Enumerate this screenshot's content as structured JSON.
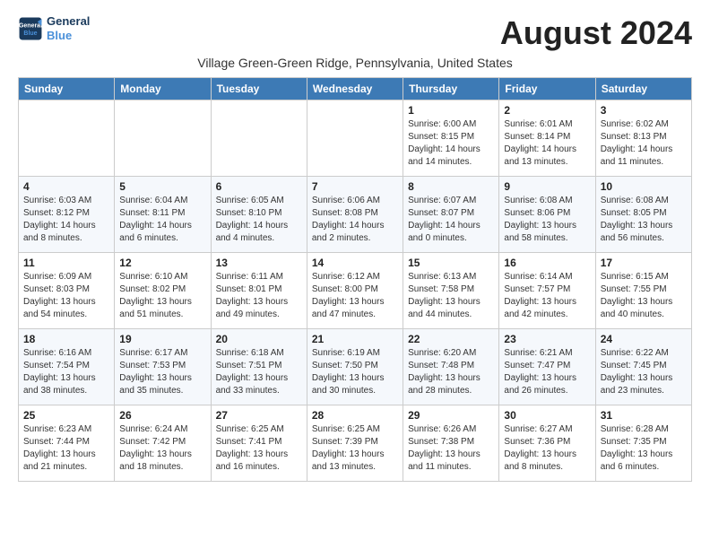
{
  "header": {
    "logo_line1": "General",
    "logo_line2": "Blue",
    "month_title": "August 2024",
    "location": "Village Green-Green Ridge, Pennsylvania, United States"
  },
  "weekdays": [
    "Sunday",
    "Monday",
    "Tuesday",
    "Wednesday",
    "Thursday",
    "Friday",
    "Saturday"
  ],
  "weeks": [
    [
      {
        "day": "",
        "info": ""
      },
      {
        "day": "",
        "info": ""
      },
      {
        "day": "",
        "info": ""
      },
      {
        "day": "",
        "info": ""
      },
      {
        "day": "1",
        "info": "Sunrise: 6:00 AM\nSunset: 8:15 PM\nDaylight: 14 hours\nand 14 minutes."
      },
      {
        "day": "2",
        "info": "Sunrise: 6:01 AM\nSunset: 8:14 PM\nDaylight: 14 hours\nand 13 minutes."
      },
      {
        "day": "3",
        "info": "Sunrise: 6:02 AM\nSunset: 8:13 PM\nDaylight: 14 hours\nand 11 minutes."
      }
    ],
    [
      {
        "day": "4",
        "info": "Sunrise: 6:03 AM\nSunset: 8:12 PM\nDaylight: 14 hours\nand 8 minutes."
      },
      {
        "day": "5",
        "info": "Sunrise: 6:04 AM\nSunset: 8:11 PM\nDaylight: 14 hours\nand 6 minutes."
      },
      {
        "day": "6",
        "info": "Sunrise: 6:05 AM\nSunset: 8:10 PM\nDaylight: 14 hours\nand 4 minutes."
      },
      {
        "day": "7",
        "info": "Sunrise: 6:06 AM\nSunset: 8:08 PM\nDaylight: 14 hours\nand 2 minutes."
      },
      {
        "day": "8",
        "info": "Sunrise: 6:07 AM\nSunset: 8:07 PM\nDaylight: 14 hours\nand 0 minutes."
      },
      {
        "day": "9",
        "info": "Sunrise: 6:08 AM\nSunset: 8:06 PM\nDaylight: 13 hours\nand 58 minutes."
      },
      {
        "day": "10",
        "info": "Sunrise: 6:08 AM\nSunset: 8:05 PM\nDaylight: 13 hours\nand 56 minutes."
      }
    ],
    [
      {
        "day": "11",
        "info": "Sunrise: 6:09 AM\nSunset: 8:03 PM\nDaylight: 13 hours\nand 54 minutes."
      },
      {
        "day": "12",
        "info": "Sunrise: 6:10 AM\nSunset: 8:02 PM\nDaylight: 13 hours\nand 51 minutes."
      },
      {
        "day": "13",
        "info": "Sunrise: 6:11 AM\nSunset: 8:01 PM\nDaylight: 13 hours\nand 49 minutes."
      },
      {
        "day": "14",
        "info": "Sunrise: 6:12 AM\nSunset: 8:00 PM\nDaylight: 13 hours\nand 47 minutes."
      },
      {
        "day": "15",
        "info": "Sunrise: 6:13 AM\nSunset: 7:58 PM\nDaylight: 13 hours\nand 44 minutes."
      },
      {
        "day": "16",
        "info": "Sunrise: 6:14 AM\nSunset: 7:57 PM\nDaylight: 13 hours\nand 42 minutes."
      },
      {
        "day": "17",
        "info": "Sunrise: 6:15 AM\nSunset: 7:55 PM\nDaylight: 13 hours\nand 40 minutes."
      }
    ],
    [
      {
        "day": "18",
        "info": "Sunrise: 6:16 AM\nSunset: 7:54 PM\nDaylight: 13 hours\nand 38 minutes."
      },
      {
        "day": "19",
        "info": "Sunrise: 6:17 AM\nSunset: 7:53 PM\nDaylight: 13 hours\nand 35 minutes."
      },
      {
        "day": "20",
        "info": "Sunrise: 6:18 AM\nSunset: 7:51 PM\nDaylight: 13 hours\nand 33 minutes."
      },
      {
        "day": "21",
        "info": "Sunrise: 6:19 AM\nSunset: 7:50 PM\nDaylight: 13 hours\nand 30 minutes."
      },
      {
        "day": "22",
        "info": "Sunrise: 6:20 AM\nSunset: 7:48 PM\nDaylight: 13 hours\nand 28 minutes."
      },
      {
        "day": "23",
        "info": "Sunrise: 6:21 AM\nSunset: 7:47 PM\nDaylight: 13 hours\nand 26 minutes."
      },
      {
        "day": "24",
        "info": "Sunrise: 6:22 AM\nSunset: 7:45 PM\nDaylight: 13 hours\nand 23 minutes."
      }
    ],
    [
      {
        "day": "25",
        "info": "Sunrise: 6:23 AM\nSunset: 7:44 PM\nDaylight: 13 hours\nand 21 minutes."
      },
      {
        "day": "26",
        "info": "Sunrise: 6:24 AM\nSunset: 7:42 PM\nDaylight: 13 hours\nand 18 minutes."
      },
      {
        "day": "27",
        "info": "Sunrise: 6:25 AM\nSunset: 7:41 PM\nDaylight: 13 hours\nand 16 minutes."
      },
      {
        "day": "28",
        "info": "Sunrise: 6:25 AM\nSunset: 7:39 PM\nDaylight: 13 hours\nand 13 minutes."
      },
      {
        "day": "29",
        "info": "Sunrise: 6:26 AM\nSunset: 7:38 PM\nDaylight: 13 hours\nand 11 minutes."
      },
      {
        "day": "30",
        "info": "Sunrise: 6:27 AM\nSunset: 7:36 PM\nDaylight: 13 hours\nand 8 minutes."
      },
      {
        "day": "31",
        "info": "Sunrise: 6:28 AM\nSunset: 7:35 PM\nDaylight: 13 hours\nand 6 minutes."
      }
    ]
  ]
}
